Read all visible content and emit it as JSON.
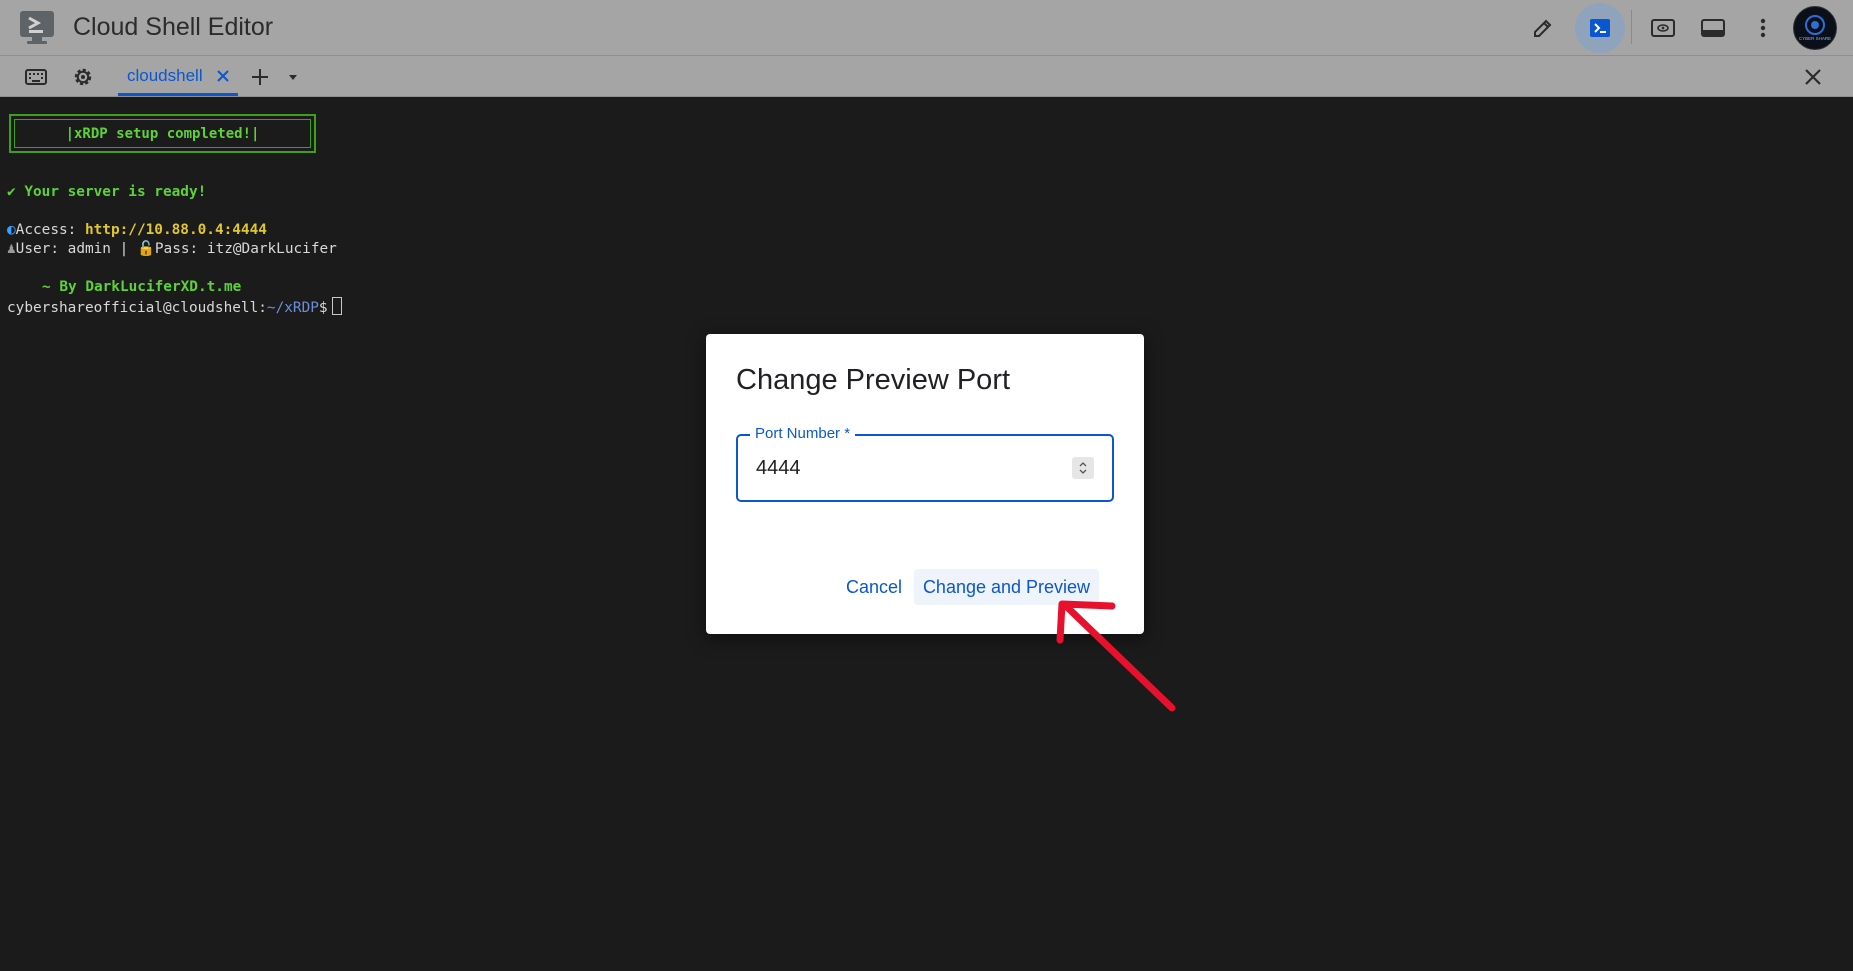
{
  "app": {
    "title": "Cloud Shell Editor",
    "logo_icon": "cloud-shell-terminal-icon",
    "toolbar_icons": [
      "pencil-icon",
      "terminal-icon",
      "web-preview-icon",
      "panel-icon",
      "more-vert-icon"
    ],
    "avatar_text": "CYBER SHARE"
  },
  "tabbar": {
    "icons": [
      "keyboard-icon",
      "gear-icon"
    ],
    "tabs": [
      {
        "label": "cloudshell",
        "active": true
      }
    ],
    "add_icon": "plus-icon",
    "dropdown_icon": "caret-down-icon",
    "close_icon": "close-icon"
  },
  "terminal": {
    "banner": "|xRDP setup completed!|",
    "ready_line": "✔ Your server is ready!",
    "access_prefix": "Access: ",
    "access_url": "http://10.88.0.4:4444",
    "user_line": "User: admin | ",
    "pass_line": "Pass: itz@DarkLucifer",
    "credit": "~ By DarkLuciferXD.t.me",
    "prompt_user": "cybershareofficial@cloudshell:",
    "prompt_path": "~/xRDP",
    "prompt_suffix": "$"
  },
  "dialog": {
    "title": "Change Preview Port",
    "field_label": "Port Number *",
    "field_value": "4444",
    "cancel_label": "Cancel",
    "confirm_label": "Change and Preview"
  },
  "colors": {
    "accent": "#0b57d0",
    "terminal_bg": "#1b1b1b",
    "annotation_arrow": "#e8112d"
  }
}
